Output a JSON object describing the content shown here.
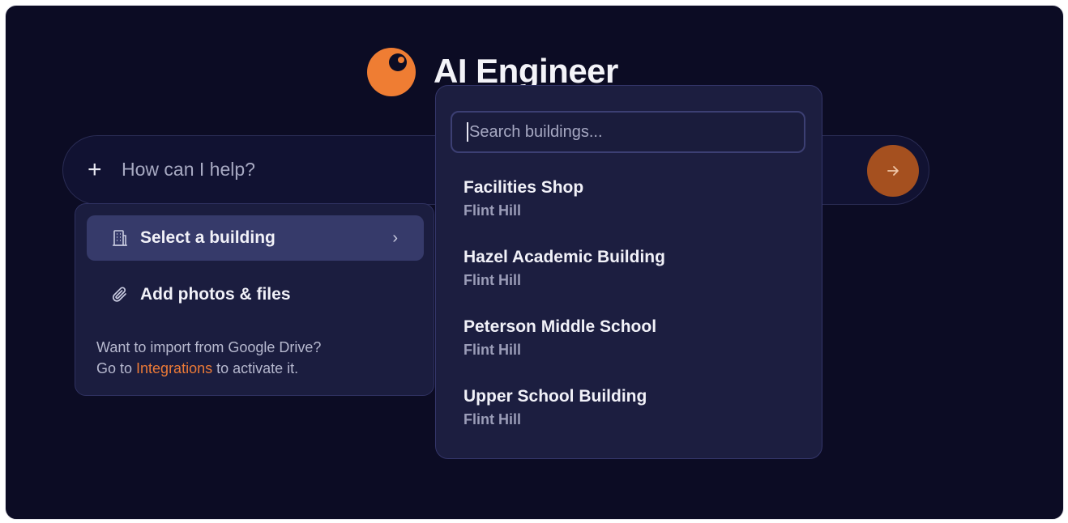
{
  "brand": {
    "name": "AI Engineer",
    "logo_color": "#ef7d33"
  },
  "prompt": {
    "plus_symbol": "+",
    "placeholder": "How can I help?",
    "send_icon": "arrow-right-icon"
  },
  "menu": {
    "items": [
      {
        "label": "Select a building",
        "icon": "building-icon",
        "active": true,
        "chevron": "›"
      },
      {
        "label": "Add photos & files",
        "icon": "paperclip-icon",
        "active": false
      }
    ],
    "import_note": {
      "line1": "Want to import from Google Drive?",
      "line2_prefix": "Go to ",
      "link": "Integrations",
      "line2_suffix": " to activate it."
    }
  },
  "buildings": {
    "search_placeholder": "Search buildings...",
    "items": [
      {
        "name": "Facilities Shop",
        "location": "Flint Hill"
      },
      {
        "name": "Hazel Academic Building",
        "location": "Flint Hill"
      },
      {
        "name": "Peterson Middle School",
        "location": "Flint Hill"
      },
      {
        "name": "Upper School Building",
        "location": "Flint Hill"
      }
    ]
  },
  "colors": {
    "background": "#0c0c24",
    "accent": "#ec7a37",
    "panel": "#1b1d3f",
    "active_item": "#363a6a"
  }
}
